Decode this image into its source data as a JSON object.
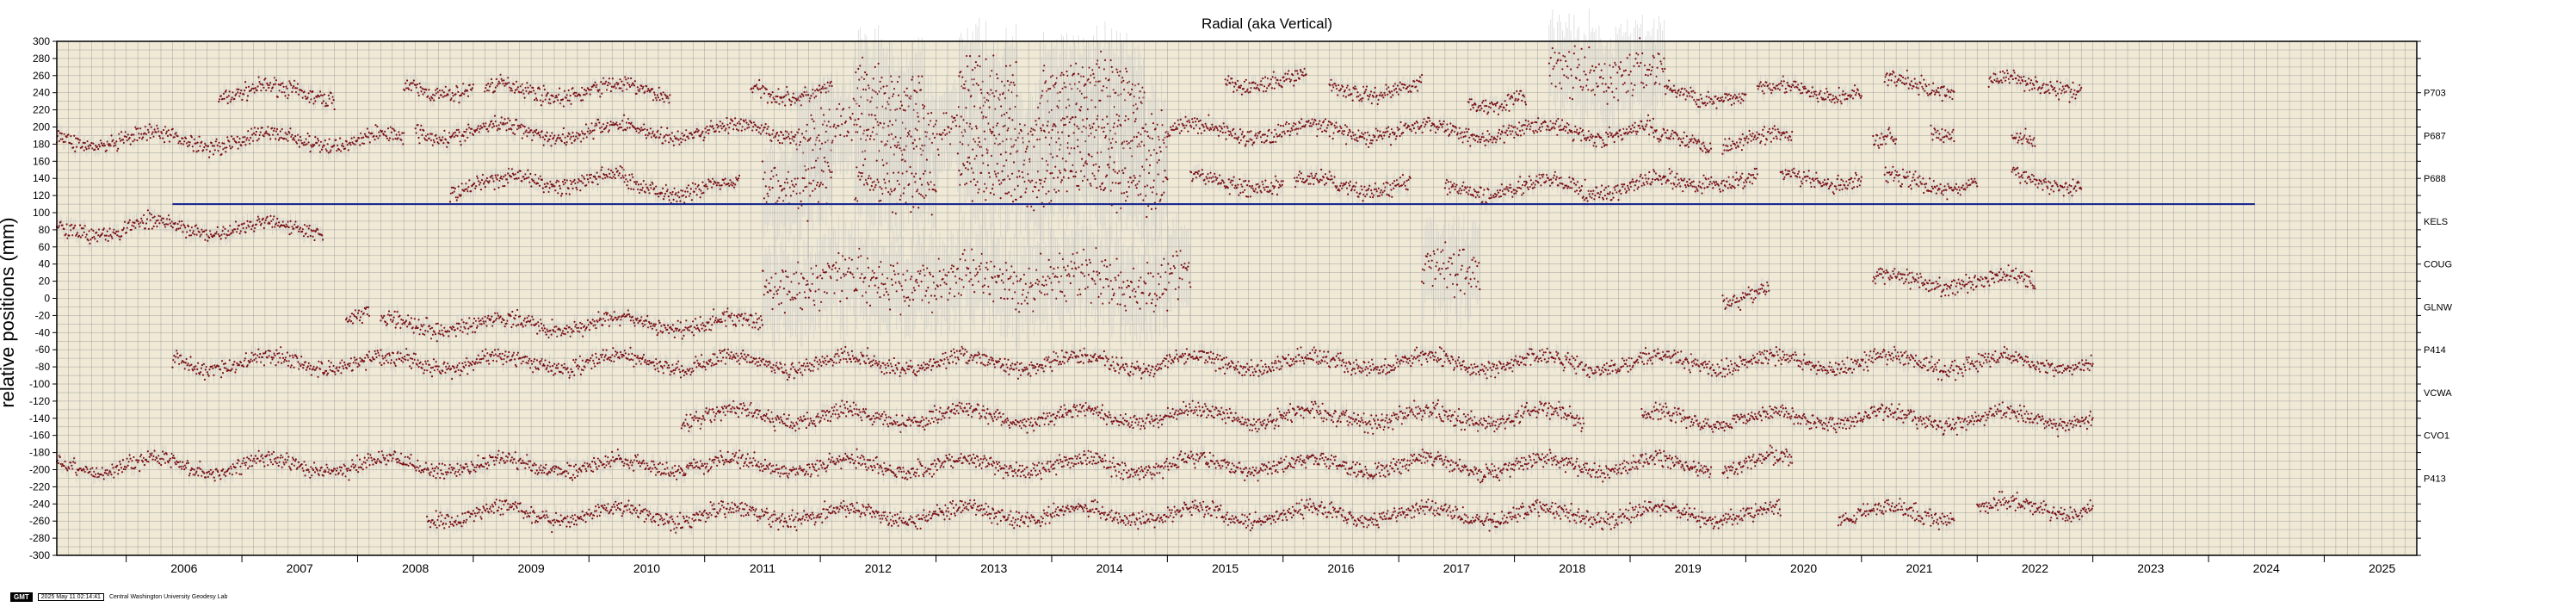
{
  "chart_data": {
    "type": "scatter",
    "title": "Radial (aka Vertical)",
    "xlabel": "",
    "ylabel": "relative positions (mm)",
    "xlim": [
      2005.4,
      2025.8
    ],
    "ylim": [
      -300,
      300
    ],
    "x_ticks": [
      "2006",
      "2007",
      "2008",
      "2009",
      "2010",
      "2011",
      "2012",
      "2013",
      "2014",
      "2015",
      "2016",
      "2017",
      "2018",
      "2019",
      "2020",
      "2021",
      "2022",
      "2023",
      "2024",
      "2025"
    ],
    "y_ticks": [
      300,
      280,
      260,
      240,
      220,
      200,
      180,
      160,
      140,
      120,
      100,
      80,
      60,
      40,
      20,
      0,
      -20,
      -40,
      -60,
      -80,
      -100,
      -120,
      -140,
      -160,
      -180,
      -200,
      -220,
      -240,
      -260,
      -280,
      -300
    ],
    "grid": true,
    "background_color": "#efe9d6",
    "grid_color": "#8a8a8a",
    "point_color": "#7a0f14",
    "error_color": "#c9c9c9",
    "reference_line": {
      "y": 110,
      "x_start": 2006.4,
      "x_end": 2024.4,
      "color": "#1a2a8f"
    },
    "series": [
      {
        "name": "P703",
        "label_y": 240,
        "segments": [
          [
            2006.8,
            2007.8,
            240
          ],
          [
            2008.4,
            2009.0,
            245
          ],
          [
            2009.1,
            2010.7,
            242
          ],
          [
            2011.4,
            2012.1,
            242
          ],
          [
            2012.3,
            2012.9,
            240
          ],
          [
            2013.2,
            2013.7,
            250
          ],
          [
            2013.9,
            2014.8,
            248
          ],
          [
            2015.5,
            2016.2,
            255
          ],
          [
            2016.4,
            2017.2,
            245
          ],
          [
            2017.6,
            2018.1,
            232
          ],
          [
            2018.3,
            2019.3,
            262
          ],
          [
            2019.3,
            2020.0,
            238
          ],
          [
            2020.1,
            2021.0,
            242
          ],
          [
            2021.2,
            2021.8,
            248
          ],
          [
            2022.1,
            2022.9,
            250
          ]
        ]
      },
      {
        "name": "P687",
        "label_y": 190,
        "segments": [
          [
            2005.4,
            2008.4,
            185
          ],
          [
            2008.5,
            2011.8,
            195
          ],
          [
            2011.8,
            2015.0,
            195
          ],
          [
            2015.0,
            2019.2,
            195
          ],
          [
            2019.2,
            2019.7,
            185
          ],
          [
            2019.8,
            2020.4,
            185
          ],
          [
            2021.1,
            2021.3,
            180
          ],
          [
            2021.6,
            2021.8,
            200
          ],
          [
            2022.3,
            2022.5,
            182
          ]
        ]
      },
      {
        "name": "P688",
        "label_y": 140,
        "segments": [
          [
            2008.8,
            2009.3,
            130
          ],
          [
            2009.3,
            2010.3,
            138
          ],
          [
            2010.3,
            2011.3,
            130
          ],
          [
            2011.5,
            2012.1,
            135
          ],
          [
            2012.3,
            2013.0,
            135
          ],
          [
            2013.2,
            2015.0,
            140
          ],
          [
            2015.2,
            2016.0,
            135
          ],
          [
            2016.1,
            2017.1,
            132
          ],
          [
            2017.4,
            2018.1,
            128
          ],
          [
            2018.1,
            2019.0,
            130
          ],
          [
            2019.0,
            2019.6,
            132
          ],
          [
            2019.6,
            2020.1,
            140
          ],
          [
            2020.3,
            2021.0,
            140
          ],
          [
            2021.2,
            2022.0,
            135
          ],
          [
            2022.3,
            2022.9,
            138
          ]
        ]
      },
      {
        "name": "KELS",
        "label_y": 90,
        "segments": [
          [
            2005.4,
            2007.7,
            82
          ]
        ]
      },
      {
        "name": "COUG",
        "label_y": 40,
        "segments": [
          [
            2011.5,
            2015.2,
            20
          ],
          [
            2017.2,
            2017.7,
            35
          ],
          [
            2019.8,
            2020.2,
            2
          ],
          [
            2021.1,
            2022.5,
            20
          ]
        ]
      },
      {
        "name": "GLNW",
        "label_y": -10,
        "segments": [
          [
            2007.9,
            2008.1,
            -20
          ],
          [
            2008.2,
            2011.5,
            -30
          ]
        ]
      },
      {
        "name": "P414",
        "label_y": -60,
        "segments": [
          [
            2006.4,
            2023.0,
            -75
          ]
        ]
      },
      {
        "name": "VCWA",
        "label_y": -110,
        "segments": [
          [
            2010.8,
            2018.6,
            -138
          ],
          [
            2019.1,
            2023.0,
            -140
          ]
        ]
      },
      {
        "name": "CVO1",
        "label_y": -160,
        "segments": [
          [
            2005.4,
            2009.7,
            -195
          ],
          [
            2009.7,
            2019.7,
            -195
          ],
          [
            2019.8,
            2020.4,
            -192
          ]
        ]
      },
      {
        "name": "P413",
        "label_y": -210,
        "segments": [
          [
            2008.6,
            2020.3,
            -252
          ],
          [
            2020.8,
            2021.8,
            -252
          ],
          [
            2022.0,
            2023.0,
            -245
          ]
        ]
      }
    ]
  },
  "footer": {
    "logo": "GMT",
    "timestamp": "2025 May 11 02:14:41",
    "credit": "Central Washington University Geodesy Lab"
  }
}
